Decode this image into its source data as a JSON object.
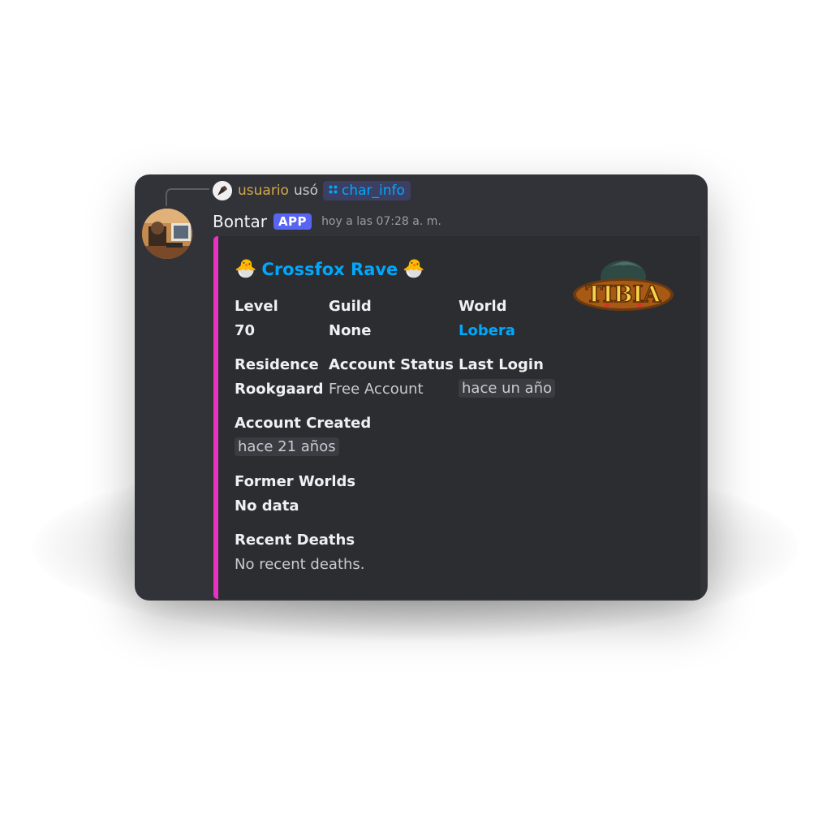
{
  "reply": {
    "user": "usuario",
    "verb": "usó",
    "command": "char_info",
    "command_icon": "slash-command-icon"
  },
  "message": {
    "author": "Bontar",
    "badge": "APP",
    "timestamp": "hoy a las 07:28 a. m."
  },
  "embed": {
    "accent_color": "#e633c2",
    "title": "Crossfox Rave",
    "title_emoji": "🐣",
    "thumbnail": "tibia-logo",
    "thumbnail_text": "TIBIA",
    "fields": {
      "level": {
        "name": "Level",
        "value": "70"
      },
      "guild": {
        "name": "Guild",
        "value": "None"
      },
      "world": {
        "name": "World",
        "value": "Lobera"
      },
      "residence": {
        "name": "Residence",
        "value": "Rookgaard"
      },
      "account_status": {
        "name": "Account Status",
        "value": "Free Account"
      },
      "last_login": {
        "name": "Last Login",
        "value": "hace un año"
      },
      "account_created": {
        "name": "Account Created",
        "value": "hace 21 años"
      },
      "former_worlds": {
        "name": "Former Worlds",
        "value": "No data"
      },
      "recent_deaths": {
        "name": "Recent Deaths",
        "value": "No recent deaths."
      }
    }
  }
}
